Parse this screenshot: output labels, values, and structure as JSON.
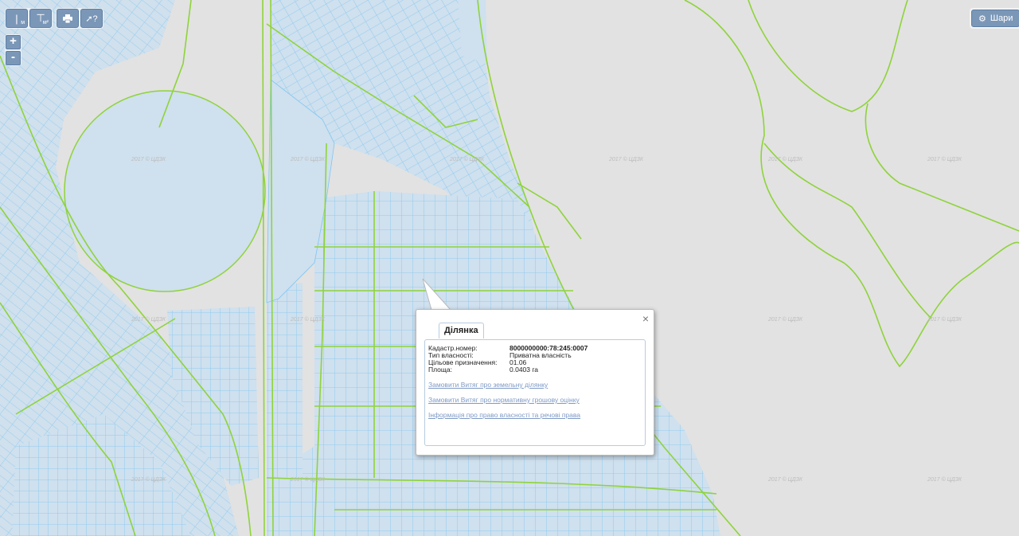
{
  "toolbar": {
    "buttons": [
      {
        "name": "measure-distance-button",
        "icon": "ruler-line-icon",
        "sub": "м"
      },
      {
        "name": "measure-area-button",
        "icon": "ruler-area-icon",
        "sub": "м²"
      },
      {
        "name": "print-button",
        "icon": "printer-icon",
        "sub": ""
      },
      {
        "name": "identify-button",
        "icon": "cursor-question-icon",
        "sub": ""
      }
    ]
  },
  "zoom": {
    "in_label": "+",
    "out_label": "-"
  },
  "layers": {
    "label": "Шари",
    "icon": "gear-icon"
  },
  "watermark": "2017 © ЦДЗК",
  "popup": {
    "tab_label": "Ділянка",
    "close_label": "×",
    "fields": [
      {
        "label": "Кадастр.номер:",
        "value": "8000000000:78:245:0007",
        "bold": true
      },
      {
        "label": "Тип власності:",
        "value": "Приватна власність",
        "bold": false
      },
      {
        "label": "Цільове призначення:",
        "value": "01.06",
        "bold": false
      },
      {
        "label": "Площа:",
        "value": "0.0403 га",
        "bold": false
      }
    ],
    "links": [
      "Замовити Витяг про земельну ділянку",
      "Замовити Витяг про нормативну грошову оцінку",
      "Інформація про право власності та речові права"
    ]
  },
  "colors": {
    "background": "#e2e2e2",
    "parcel_fill": "#cfe0ee",
    "parcel_stroke": "#7fc6f0",
    "boundary": "#8fd33a",
    "button": "#7b97b8",
    "link": "#7e9ac6"
  }
}
